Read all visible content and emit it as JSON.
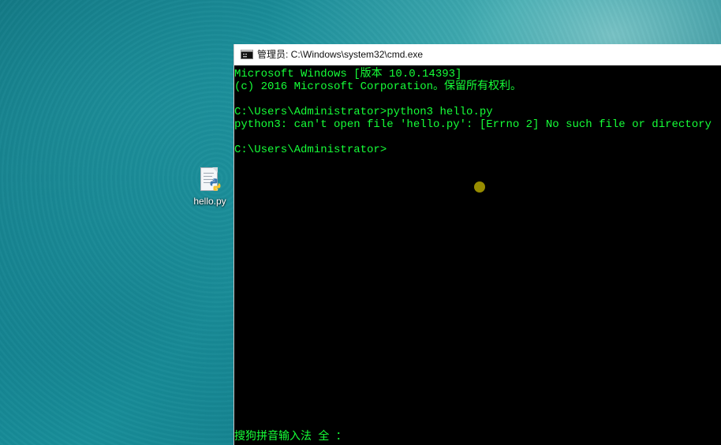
{
  "desktop": {
    "icon_label": "hello.py"
  },
  "window": {
    "title": "管理员: C:\\Windows\\system32\\cmd.exe"
  },
  "console": {
    "lines": [
      "Microsoft Windows [版本 10.0.14393]",
      "(c) 2016 Microsoft Corporation。保留所有权利。",
      "",
      "C:\\Users\\Administrator>python3 hello.py",
      "python3: can't open file 'hello.py': [Errno 2] No such file or directory",
      "",
      "C:\\Users\\Administrator>"
    ],
    "ime_status": "搜狗拼音输入法 全 ："
  },
  "colors": {
    "console_text": "#16ff38",
    "console_background": "#000000",
    "cursor_highlight": "#9f9400",
    "desktop_teal": "#168b98"
  }
}
